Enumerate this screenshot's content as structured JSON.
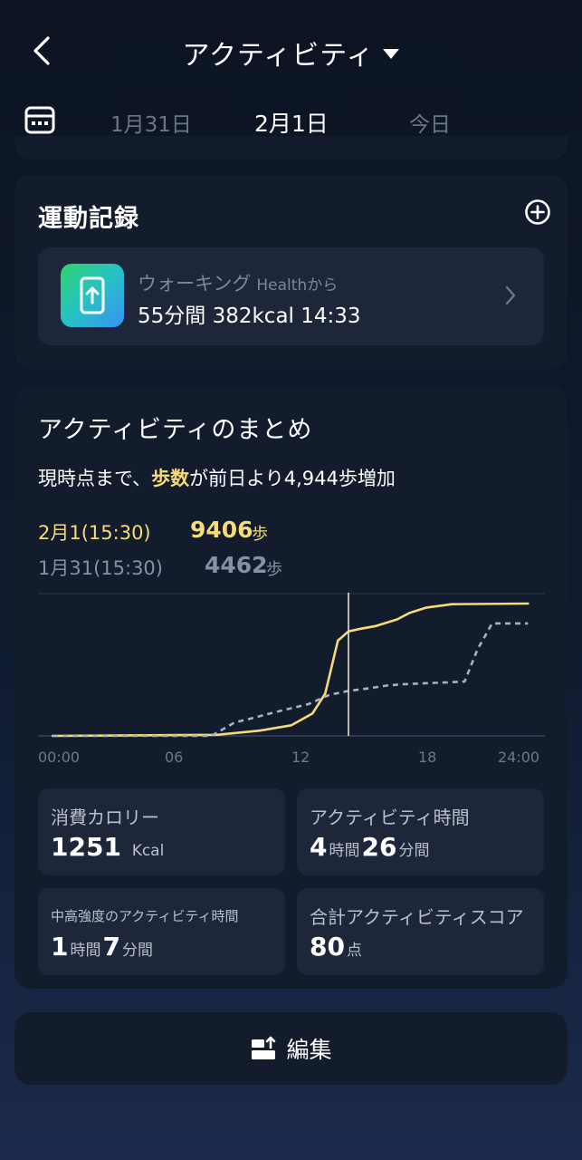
{
  "header": {
    "title": "アクティビティ"
  },
  "dates": {
    "prev": "1月31日",
    "current": "2月1日",
    "next": "今日"
  },
  "record": {
    "title": "運動記録",
    "item": {
      "name": "ウォーキング",
      "source": "Healthから",
      "details": "55分間 382kcal 14:33"
    }
  },
  "summary": {
    "title": "アクティビティのまとめ",
    "desc_prefix": "現時点まで、",
    "desc_highlight": "歩数",
    "desc_suffix": "が前日より4,944歩増加",
    "legend": [
      {
        "label": "2月1(15:30)",
        "value": "9406",
        "unit": "歩"
      },
      {
        "label": "1月31(15:30)",
        "value": "4462",
        "unit": "歩"
      }
    ]
  },
  "chart_data": {
    "type": "line",
    "x_ticks": [
      "00:00",
      "06",
      "12",
      "18",
      "24:00"
    ],
    "xlim": [
      0,
      24
    ],
    "ylim": [
      0,
      10000
    ],
    "cursor_x": 14.7,
    "series": [
      {
        "label": "2月1(15:30)",
        "style": "solid",
        "color": "#f5dc78",
        "x": [
          0.7,
          8.5,
          10.5,
          12,
          13,
          13.6,
          14.2,
          14.7,
          15.3,
          16,
          17,
          17.6,
          18.4,
          19.6,
          23.2
        ],
        "y": [
          0,
          80,
          400,
          800,
          1700,
          3200,
          7200,
          7900,
          8100,
          8300,
          8800,
          9300,
          9700,
          9950,
          10000
        ]
      },
      {
        "label": "1月31(15:30)",
        "style": "dashed",
        "color": "#a9b2c2",
        "x": [
          0.7,
          8.2,
          9.3,
          11.5,
          12.8,
          13.8,
          14.7,
          15.7,
          16.5,
          17.2,
          20.2,
          20.8,
          21.5,
          23.2
        ],
        "y": [
          0,
          0,
          1000,
          1900,
          2400,
          3100,
          3400,
          3600,
          3800,
          3900,
          4100,
          6500,
          8500,
          8500
        ]
      }
    ]
  },
  "stats": {
    "calories": {
      "label": "消費カロリー",
      "value": "1251",
      "unit": "Kcal"
    },
    "active_time": {
      "label": "アクティビティ時間",
      "h": "4",
      "h_unit": "時間",
      "m": "26",
      "m_unit": "分間"
    },
    "mvpa_time": {
      "label": "中高強度のアクティビティ時間",
      "h": "1",
      "h_unit": "時間",
      "m": "7",
      "m_unit": "分間"
    },
    "score": {
      "label": "合計アクティビティスコア",
      "value": "80",
      "unit": "点"
    }
  },
  "edit": {
    "label": "編集"
  }
}
